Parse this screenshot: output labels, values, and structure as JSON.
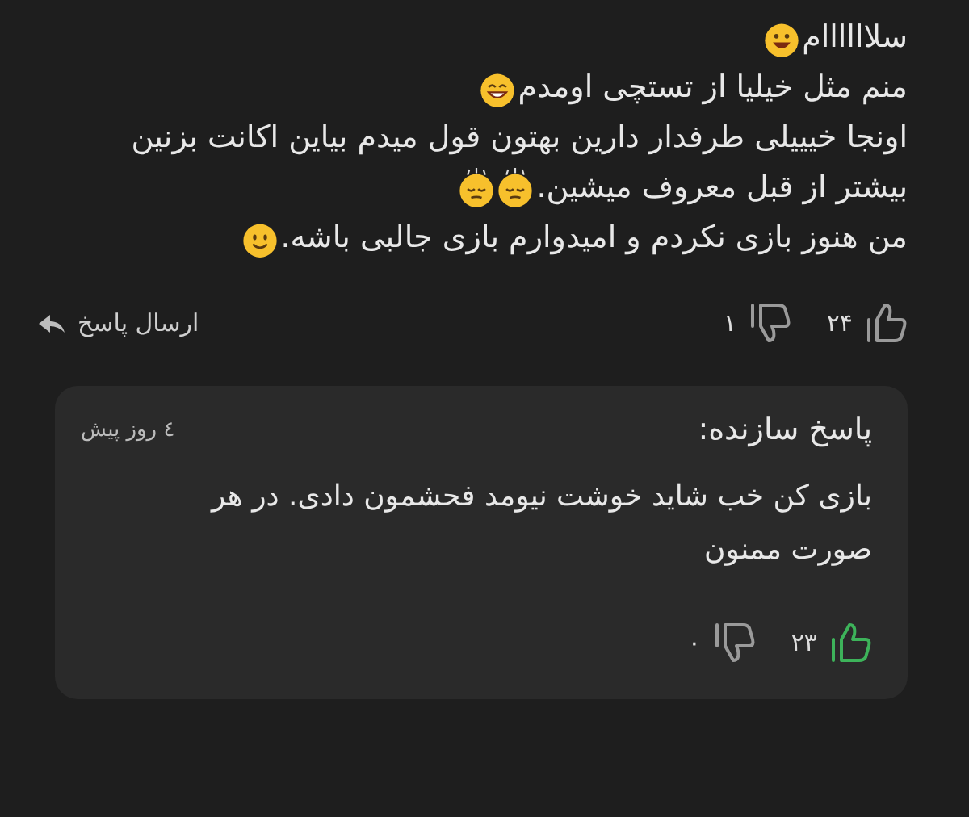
{
  "comment": {
    "lines": [
      {
        "text": "سلاااااام",
        "emojis": [
          {
            "kind": "grin"
          }
        ]
      },
      {
        "text": "منم مثل خیلیا از تستچی اومدم",
        "emojis": [
          {
            "kind": "laugh"
          }
        ]
      },
      {
        "text": "اونجا خیییلی طرفدار دارین بهتون قول میدم بیاین اکانت بزنین"
      },
      {
        "text": "بیشتر از قبل معروف میشین.",
        "emojis": [
          {
            "kind": "relieved"
          },
          {
            "kind": "relieved"
          }
        ]
      },
      {
        "text": "من هنوز بازی نکردم و امیدوارم بازی جالبی باشه.",
        "emojis": [
          {
            "kind": "smile"
          }
        ]
      }
    ],
    "likes": {
      "count": "۲۴",
      "selected": false
    },
    "dislikes": {
      "count": "۱",
      "selected": false
    },
    "reply_button": "ارسال پاسخ"
  },
  "developer_reply": {
    "title": "پاسخ سازنده:",
    "time": "٤ روز پیش",
    "text": "بازی کن خب شاید خوشت نیومد فحشمون دادی. در هر صورت ممنون",
    "likes": {
      "count": "۲۳",
      "selected": true
    },
    "dislikes": {
      "count": "۰",
      "selected": false
    }
  }
}
